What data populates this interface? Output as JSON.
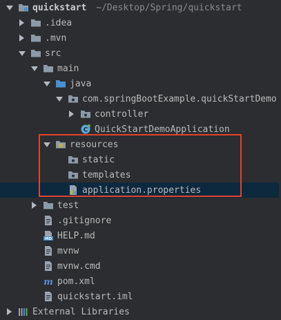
{
  "project": {
    "name": "quickstart",
    "path": "~/Desktop/Spring/quickstart"
  },
  "tree": [
    {
      "label": "quickstart",
      "path": "~/Desktop/Spring/quickstart",
      "depth": 0,
      "arrow": "down",
      "icon": "module-folder-icon",
      "bold": true
    },
    {
      "label": ".idea",
      "depth": 1,
      "arrow": "right",
      "icon": "folder-icon"
    },
    {
      "label": ".mvn",
      "depth": 1,
      "arrow": "right",
      "icon": "folder-icon"
    },
    {
      "label": "src",
      "depth": 1,
      "arrow": "down",
      "icon": "folder-icon"
    },
    {
      "label": "main",
      "depth": 2,
      "arrow": "down",
      "icon": "folder-icon"
    },
    {
      "label": "java",
      "depth": 3,
      "arrow": "down",
      "icon": "source-folder-icon"
    },
    {
      "label": "com.springBootExample.quickStartDemo",
      "depth": 4,
      "arrow": "down",
      "icon": "package-icon"
    },
    {
      "label": "controller",
      "depth": 5,
      "arrow": "right",
      "icon": "package-icon"
    },
    {
      "label": "QuickStartDemoApplication",
      "depth": 5,
      "arrow": "none",
      "icon": "spring-class-icon"
    },
    {
      "label": "resources",
      "depth": 3,
      "arrow": "down",
      "icon": "resources-folder-icon"
    },
    {
      "label": "static",
      "depth": 4,
      "arrow": "none",
      "icon": "package-icon"
    },
    {
      "label": "templates",
      "depth": 4,
      "arrow": "none",
      "icon": "package-icon"
    },
    {
      "label": "application.properties",
      "depth": 4,
      "arrow": "none",
      "icon": "properties-file-icon",
      "selected": true
    },
    {
      "label": "test",
      "depth": 2,
      "arrow": "right",
      "icon": "folder-icon"
    },
    {
      "label": ".gitignore",
      "depth": 2,
      "arrow": "none",
      "icon": "text-file-icon"
    },
    {
      "label": "HELP.md",
      "depth": 2,
      "arrow": "none",
      "icon": "markdown-file-icon"
    },
    {
      "label": "mvnw",
      "depth": 2,
      "arrow": "none",
      "icon": "text-file-icon"
    },
    {
      "label": "mvnw.cmd",
      "depth": 2,
      "arrow": "none",
      "icon": "text-file-icon"
    },
    {
      "label": "pom.xml",
      "depth": 2,
      "arrow": "none",
      "icon": "maven-icon"
    },
    {
      "label": "quickstart.iml",
      "depth": 2,
      "arrow": "none",
      "icon": "text-file-icon"
    },
    {
      "label": "External Libraries",
      "depth": 0,
      "arrow": "right",
      "icon": "libraries-icon"
    }
  ],
  "colors": {
    "background": "#2b2d30",
    "selection": "#0d293e",
    "highlight_border": "#e5432b",
    "folder": "#8c9aa6",
    "source_folder": "#4a8fd1",
    "spring": "#5ba7d8"
  }
}
